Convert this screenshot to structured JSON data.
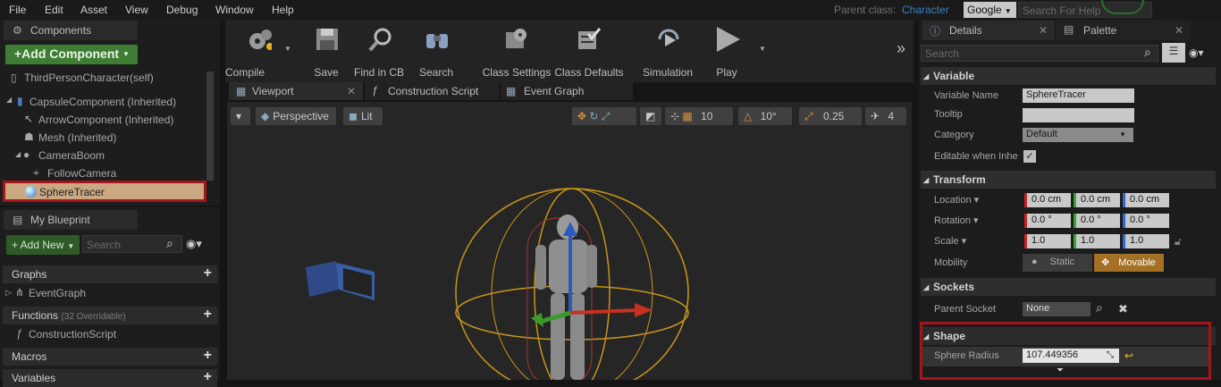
{
  "menubar": {
    "items": [
      "File",
      "Edit",
      "Asset",
      "View",
      "Debug",
      "Window",
      "Help"
    ],
    "parent_class_label": "Parent class:",
    "parent_class_value": "Character",
    "search_engine": "Google",
    "help_search_placeholder": "Search For Help"
  },
  "components": {
    "tab_label": "Components",
    "add_button": "+Add Component",
    "items": [
      {
        "label": "ThirdPersonCharacter(self)"
      },
      {
        "label": "CapsuleComponent (Inherited)"
      },
      {
        "label": "ArrowComponent (Inherited)"
      },
      {
        "label": "Mesh (Inherited)"
      },
      {
        "label": "CameraBoom"
      },
      {
        "label": "FollowCamera"
      },
      {
        "label": "SphereTracer"
      }
    ]
  },
  "my_blueprint": {
    "tab_label": "My Blueprint",
    "add_new": "+ Add New",
    "search_placeholder": "Search",
    "sections": [
      {
        "label": "Graphs"
      },
      {
        "label": "EventGraph"
      },
      {
        "label": "Functions",
        "extra": "(32 Overridable)"
      },
      {
        "label": "ConstructionScript"
      },
      {
        "label": "Macros"
      },
      {
        "label": "Variables"
      }
    ]
  },
  "toolbar": {
    "buttons": [
      {
        "label": "Compile"
      },
      {
        "label": "Save"
      },
      {
        "label": "Find in CB"
      },
      {
        "label": "Search"
      },
      {
        "label": "Class Settings"
      },
      {
        "label": "Class Defaults"
      },
      {
        "label": "Simulation"
      },
      {
        "label": "Play"
      }
    ]
  },
  "editor_tabs": [
    {
      "label": "Viewport"
    },
    {
      "label": "Construction Script"
    },
    {
      "label": "Event Graph"
    }
  ],
  "viewport": {
    "perspective": "Perspective",
    "lit": "Lit",
    "grid_snap": "10",
    "rot_snap": "10°",
    "scale_snap": "0.25",
    "cam_speed": "4"
  },
  "details": {
    "tab_label": "Details",
    "palette_label": "Palette",
    "search_placeholder": "Search",
    "variable": {
      "header": "Variable",
      "name_label": "Variable Name",
      "name_value": "SphereTracer",
      "tooltip_label": "Tooltip",
      "tooltip_value": "",
      "category_label": "Category",
      "category_value": "Default",
      "editable_label": "Editable when Inhe"
    },
    "transform": {
      "header": "Transform",
      "location_label": "Location",
      "location": [
        "0.0 cm",
        "0.0 cm",
        "0.0 cm"
      ],
      "rotation_label": "Rotation",
      "rotation": [
        "0.0 °",
        "0.0 °",
        "0.0 °"
      ],
      "scale_label": "Scale",
      "scale": [
        "1.0",
        "1.0",
        "1.0"
      ],
      "mobility_label": "Mobility",
      "mobility_static": "Static",
      "mobility_movable": "Movable"
    },
    "sockets": {
      "header": "Sockets",
      "parent_socket_label": "Parent Socket",
      "parent_socket_value": "None"
    },
    "shape": {
      "header": "Shape",
      "sphere_radius_label": "Sphere Radius",
      "sphere_radius_value": "107.449356"
    }
  }
}
